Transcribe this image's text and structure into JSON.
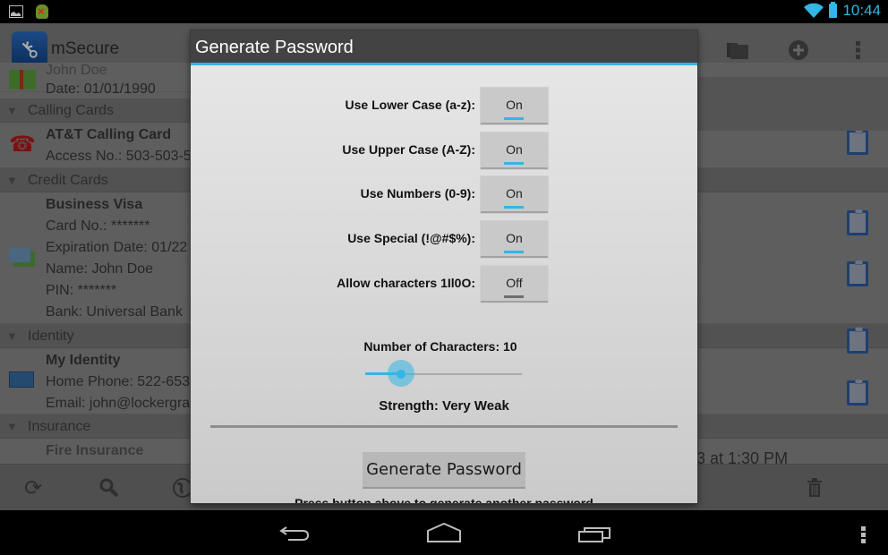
{
  "status_bar": {
    "time": "10:44",
    "left_icons": [
      "gallery-icon",
      "android-debug-icon"
    ],
    "right_icons": [
      "wifi-icon",
      "battery-icon"
    ]
  },
  "app": {
    "title": "mSecure",
    "action_icons": [
      "folder-icon",
      "add-icon",
      "overflow-menu-icon"
    ],
    "list": {
      "partial_top_item": {
        "name": "John Doe",
        "lines": [
          "Date: 01/01/1990"
        ],
        "icon": "gift-icon"
      },
      "groups": [
        {
          "header": "Calling Cards",
          "items": [
            {
              "name": "AT&T Calling Card",
              "lines": [
                "Access No.: 503-503-5"
              ],
              "icon": "phone-icon"
            }
          ]
        },
        {
          "header": "Credit Cards",
          "items": [
            {
              "name": "Business Visa",
              "lines": [
                "Card No.: *******",
                "Expiration Date: 01/22",
                "Name: John Doe",
                "PIN: *******",
                "Bank: Universal Bank"
              ],
              "icon": "credit-card-icon"
            }
          ]
        },
        {
          "header": "Identity",
          "items": [
            {
              "name": "My Identity",
              "lines": [
                "Home Phone: 522-653",
                "Email: john@lockergra"
              ],
              "icon": "id-card-icon"
            }
          ]
        },
        {
          "header": "Insurance",
          "items": [
            {
              "name": "Fire Insurance",
              "lines": [],
              "icon": "insurance-icon"
            }
          ]
        }
      ],
      "right_detail_text": "3 at 1:30 PM"
    },
    "bottom_icons": [
      "sync-icon",
      "search-icon",
      "globe-icon",
      "trash-icon"
    ]
  },
  "dialog": {
    "title": "Generate Password",
    "options": [
      {
        "label": "Use Lower Case (a-z):",
        "value": "On",
        "on": true
      },
      {
        "label": "Use Upper Case (A-Z):",
        "value": "On",
        "on": true
      },
      {
        "label": "Use Numbers (0-9):",
        "value": "On",
        "on": true
      },
      {
        "label": "Use Special (!@#$%):",
        "value": "On",
        "on": true
      },
      {
        "label": "Allow characters 1Il0O:",
        "value": "Off",
        "on": false
      }
    ],
    "num_chars_label": "Number of Characters: 10",
    "num_chars": 10,
    "slider_fraction": 0.23,
    "strength_label": "Strength:",
    "strength_value": "Very Weak",
    "generate_button": "Generate Password",
    "hint": "Press button above to generate another password"
  },
  "nav_bar": {
    "buttons": [
      "back-icon",
      "home-icon",
      "recent-apps-icon",
      "overflow-menu-icon"
    ]
  },
  "colors": {
    "accent": "#33b5e5",
    "toggle_off_indicator": "#6f6f6f",
    "dialog_title_bg": "#434343"
  }
}
